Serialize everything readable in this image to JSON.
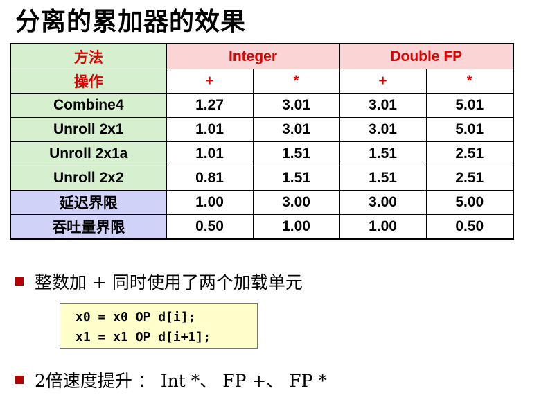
{
  "title": "分离的累加器的效果",
  "table": {
    "header1": {
      "label": "方法",
      "group1": "Integer",
      "group2": "Double FP"
    },
    "header2": {
      "label": "操作",
      "ops": [
        "+",
        "*",
        "+",
        "*"
      ]
    },
    "rows": [
      {
        "label": "Combine4",
        "values": [
          "1.27",
          "3.01",
          "3.01",
          "5.01"
        ]
      },
      {
        "label": "Unroll 2x1",
        "values": [
          "1.01",
          "3.01",
          "3.01",
          "5.01"
        ]
      },
      {
        "label": "Unroll 2x1a",
        "values": [
          "1.01",
          "1.51",
          "1.51",
          "2.51"
        ]
      },
      {
        "label": "Unroll 2x2",
        "values": [
          "0.81",
          "1.51",
          "1.51",
          "2.51"
        ]
      },
      {
        "label": "延迟界限",
        "values": [
          "1.00",
          "3.00",
          "3.00",
          "5.00"
        ]
      },
      {
        "label": "吞吐量界限",
        "values": [
          "0.50",
          "1.00",
          "1.00",
          "0.50"
        ]
      }
    ]
  },
  "bullets": [
    "整数加 +  同时使用了两个加载单元",
    "2倍速度提升 ： Int *、 FP +、 FP *"
  ],
  "code": [
    "x0 = x0 OP d[i];",
    "x1 = x1 OP d[i+1];"
  ],
  "colors": {
    "header_pink": "#fbd5d5",
    "row_green": "#d6f0cf",
    "row_blue": "#d0d3f7",
    "code_bg": "#ffffcc",
    "accent_red": "#e00000"
  }
}
